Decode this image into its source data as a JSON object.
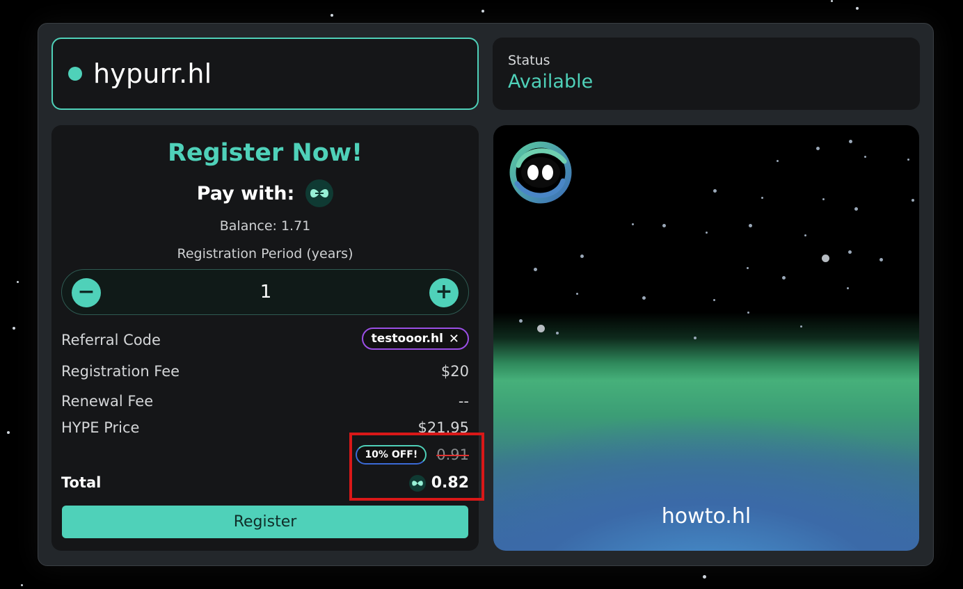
{
  "domain_name": "hypurr.hl",
  "status": {
    "label": "Status",
    "value": "Available"
  },
  "register": {
    "title": "Register Now!",
    "pay_with_label": "Pay with:",
    "balance": "Balance: 1.71",
    "period_label": "Registration Period (years)",
    "period_value": "1",
    "minus_symbol": "−",
    "plus_symbol": "+",
    "referral_label": "Referral Code",
    "referral_code": "testooor.hl",
    "referral_close": "✕",
    "fee_label": "Registration Fee",
    "fee_value": "$20",
    "renewal_label": "Renewal Fee",
    "renewal_value": "--",
    "price_label": "HYPE Price",
    "price_value": "$21.95",
    "discount_badge": "10% OFF!",
    "original_total": "0.91",
    "total_label": "Total",
    "total_value": "0.82",
    "button_label": "Register"
  },
  "preview": {
    "name": "howto.hl"
  },
  "colors": {
    "accent": "#4fd1b9",
    "referral_border": "#9b4fe6",
    "highlight": "#d91818",
    "strike": "#e0302f"
  },
  "icons": {
    "name_status": "status-dot-icon",
    "currency": "hype-token-icon",
    "logo": "hypurr-logo-icon"
  }
}
